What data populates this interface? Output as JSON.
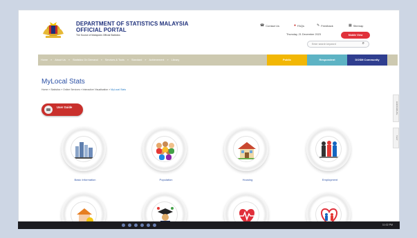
{
  "header": {
    "title_line1": "DEPARTMENT OF STATISTICS MALAYSIA",
    "title_line2": "OFFICIAL PORTAL",
    "subtitle": "The Source of Malaysia's Official Statistics",
    "contact_us": "Contact Us",
    "faqs": "FAQs",
    "feedback": "Feedback",
    "sitemap": "Sitemap",
    "date": "Thursday, 21 December 2023",
    "red_button": "Mobile View",
    "search_placeholder": "Enter search keyword"
  },
  "nav": {
    "items": [
      "Home",
      "About Us",
      "Statistics On Demand",
      "Services & Tools",
      "Standard",
      "Achievement",
      "Library"
    ],
    "tab_public": "Public",
    "tab_respondent": "Respondent",
    "tab_community": "DOSM Community"
  },
  "page": {
    "title": "MyLocal Stats",
    "breadcrumb": "Home » Statistics » Online Services » Interactive Visualisation » ",
    "breadcrumb_current": "MyLocal Stats",
    "user_guide": "User Guide",
    "side_tab_1": "CONTRIBUTE",
    "side_tab_2": "TEXT"
  },
  "tiles": [
    {
      "label": "Basic Information",
      "icon": "city-skyline-icon"
    },
    {
      "label": "Population",
      "icon": "people-crowd-icon"
    },
    {
      "label": "Housing",
      "icon": "house-icon"
    },
    {
      "label": "Employment",
      "icon": "workers-icon"
    },
    {
      "label": "",
      "icon": "house-coins-icon"
    },
    {
      "label": "",
      "icon": "graduate-icon"
    },
    {
      "label": "",
      "icon": "heart-pulse-icon"
    },
    {
      "label": "",
      "icon": "family-heart-icon"
    }
  ],
  "taskbar": {
    "clock": "11:02 PM"
  },
  "colors": {
    "accent_blue": "#2b50a5",
    "nav_bg": "#cdc9b0",
    "public": "#f2b705",
    "respondent": "#5db3c4",
    "community": "#2f3e8f",
    "red": "#e0313a"
  }
}
